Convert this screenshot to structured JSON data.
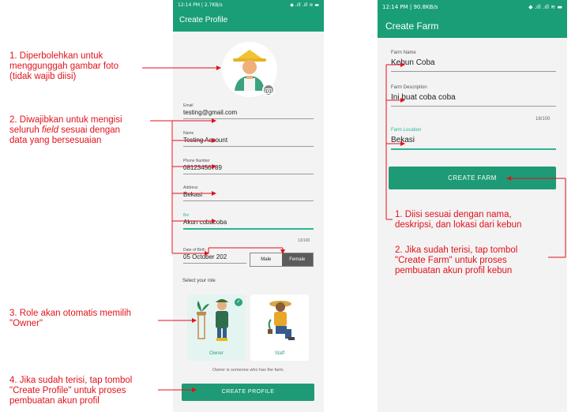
{
  "create_profile_screen": {
    "status": {
      "left": "12:14 PM | 2.7KB/s",
      "right": "◆ .ıll .ıll ≋ ▬"
    },
    "title": "Create Profile",
    "fields": [
      {
        "label": "Email",
        "value": "testing@gmail.com"
      },
      {
        "label": "Name",
        "value": "Testing Account"
      },
      {
        "label": "Phone Number",
        "value": "08123456789"
      },
      {
        "label": "Address",
        "value": "Bekasi"
      },
      {
        "label": "Bio",
        "value": "Akun cobacoba",
        "counter": "13/100"
      }
    ],
    "dob": {
      "label": "Date of Birth",
      "value": "05 October 202"
    },
    "gender": {
      "options": [
        "Male",
        "Female"
      ],
      "selected": "Female"
    },
    "roles": {
      "heading": "Select your role",
      "items": [
        "Owner",
        "Staff"
      ],
      "selected": "Owner",
      "hint": "Owner is someone who has the farm."
    },
    "button": "CREATE PROFILE"
  },
  "create_farm_screen": {
    "status": {
      "left": "12:14 PM | 90.8KB/s",
      "right": "◆ .ıll .ıll ≋ ▬"
    },
    "title": "Create Farm",
    "fields": [
      {
        "label": "Farm Name",
        "value": "Kebun Coba"
      },
      {
        "label": "Farm Description",
        "value": "Ini buat coba coba",
        "counter": "18/100"
      },
      {
        "label": "Farm Location",
        "value": "Bekasi"
      }
    ],
    "button": "CREATE FARM"
  },
  "annotations": {
    "note1": "1. Diperbolehkan untuk\nmenggunggah gambar foto\n(tidak wajib diisi)",
    "note2a": "2. Diwajibkan untuk mengisi\nseluruh ",
    "note2_field": "field",
    "note2b": " sesuai dengan\ndata yang bersesuaian",
    "note3": "3. Role akan otomatis memilih\n\"Owner\"",
    "note4": "4. Jika sudah terisi, tap tombol\n\"Create Profile\" untuk proses\npembuatan akun profil",
    "farm_note1": "1. Diisi sesuai dengan nama,\ndeskripsi, dan lokasi dari kebun",
    "farm_note2": "2. Jika sudah terisi, tap tombol\n\"Create Farm\" untuk proses\npembuatan akun profil kebun"
  },
  "colors": {
    "primary": "#1a9e78",
    "accent": "#2bb596",
    "annotation": "#e2121b"
  }
}
